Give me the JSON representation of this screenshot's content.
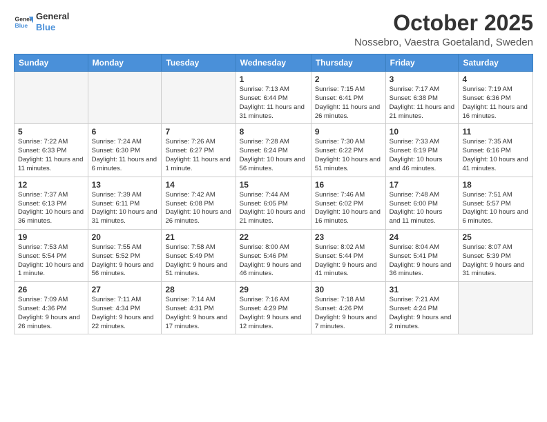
{
  "logo": {
    "line1": "General",
    "line2": "Blue"
  },
  "title": "October 2025",
  "subtitle": "Nossebro, Vaestra Goetaland, Sweden",
  "days_of_week": [
    "Sunday",
    "Monday",
    "Tuesday",
    "Wednesday",
    "Thursday",
    "Friday",
    "Saturday"
  ],
  "weeks": [
    [
      {
        "day": "",
        "info": ""
      },
      {
        "day": "",
        "info": ""
      },
      {
        "day": "",
        "info": ""
      },
      {
        "day": "1",
        "info": "Sunrise: 7:13 AM\nSunset: 6:44 PM\nDaylight: 11 hours\nand 31 minutes."
      },
      {
        "day": "2",
        "info": "Sunrise: 7:15 AM\nSunset: 6:41 PM\nDaylight: 11 hours\nand 26 minutes."
      },
      {
        "day": "3",
        "info": "Sunrise: 7:17 AM\nSunset: 6:38 PM\nDaylight: 11 hours\nand 21 minutes."
      },
      {
        "day": "4",
        "info": "Sunrise: 7:19 AM\nSunset: 6:36 PM\nDaylight: 11 hours\nand 16 minutes."
      }
    ],
    [
      {
        "day": "5",
        "info": "Sunrise: 7:22 AM\nSunset: 6:33 PM\nDaylight: 11 hours\nand 11 minutes."
      },
      {
        "day": "6",
        "info": "Sunrise: 7:24 AM\nSunset: 6:30 PM\nDaylight: 11 hours\nand 6 minutes."
      },
      {
        "day": "7",
        "info": "Sunrise: 7:26 AM\nSunset: 6:27 PM\nDaylight: 11 hours\nand 1 minute."
      },
      {
        "day": "8",
        "info": "Sunrise: 7:28 AM\nSunset: 6:24 PM\nDaylight: 10 hours\nand 56 minutes."
      },
      {
        "day": "9",
        "info": "Sunrise: 7:30 AM\nSunset: 6:22 PM\nDaylight: 10 hours\nand 51 minutes."
      },
      {
        "day": "10",
        "info": "Sunrise: 7:33 AM\nSunset: 6:19 PM\nDaylight: 10 hours\nand 46 minutes."
      },
      {
        "day": "11",
        "info": "Sunrise: 7:35 AM\nSunset: 6:16 PM\nDaylight: 10 hours\nand 41 minutes."
      }
    ],
    [
      {
        "day": "12",
        "info": "Sunrise: 7:37 AM\nSunset: 6:13 PM\nDaylight: 10 hours\nand 36 minutes."
      },
      {
        "day": "13",
        "info": "Sunrise: 7:39 AM\nSunset: 6:11 PM\nDaylight: 10 hours\nand 31 minutes."
      },
      {
        "day": "14",
        "info": "Sunrise: 7:42 AM\nSunset: 6:08 PM\nDaylight: 10 hours\nand 26 minutes."
      },
      {
        "day": "15",
        "info": "Sunrise: 7:44 AM\nSunset: 6:05 PM\nDaylight: 10 hours\nand 21 minutes."
      },
      {
        "day": "16",
        "info": "Sunrise: 7:46 AM\nSunset: 6:02 PM\nDaylight: 10 hours\nand 16 minutes."
      },
      {
        "day": "17",
        "info": "Sunrise: 7:48 AM\nSunset: 6:00 PM\nDaylight: 10 hours\nand 11 minutes."
      },
      {
        "day": "18",
        "info": "Sunrise: 7:51 AM\nSunset: 5:57 PM\nDaylight: 10 hours\nand 6 minutes."
      }
    ],
    [
      {
        "day": "19",
        "info": "Sunrise: 7:53 AM\nSunset: 5:54 PM\nDaylight: 10 hours\nand 1 minute."
      },
      {
        "day": "20",
        "info": "Sunrise: 7:55 AM\nSunset: 5:52 PM\nDaylight: 9 hours\nand 56 minutes."
      },
      {
        "day": "21",
        "info": "Sunrise: 7:58 AM\nSunset: 5:49 PM\nDaylight: 9 hours\nand 51 minutes."
      },
      {
        "day": "22",
        "info": "Sunrise: 8:00 AM\nSunset: 5:46 PM\nDaylight: 9 hours\nand 46 minutes."
      },
      {
        "day": "23",
        "info": "Sunrise: 8:02 AM\nSunset: 5:44 PM\nDaylight: 9 hours\nand 41 minutes."
      },
      {
        "day": "24",
        "info": "Sunrise: 8:04 AM\nSunset: 5:41 PM\nDaylight: 9 hours\nand 36 minutes."
      },
      {
        "day": "25",
        "info": "Sunrise: 8:07 AM\nSunset: 5:39 PM\nDaylight: 9 hours\nand 31 minutes."
      }
    ],
    [
      {
        "day": "26",
        "info": "Sunrise: 7:09 AM\nSunset: 4:36 PM\nDaylight: 9 hours\nand 26 minutes."
      },
      {
        "day": "27",
        "info": "Sunrise: 7:11 AM\nSunset: 4:34 PM\nDaylight: 9 hours\nand 22 minutes."
      },
      {
        "day": "28",
        "info": "Sunrise: 7:14 AM\nSunset: 4:31 PM\nDaylight: 9 hours\nand 17 minutes."
      },
      {
        "day": "29",
        "info": "Sunrise: 7:16 AM\nSunset: 4:29 PM\nDaylight: 9 hours\nand 12 minutes."
      },
      {
        "day": "30",
        "info": "Sunrise: 7:18 AM\nSunset: 4:26 PM\nDaylight: 9 hours\nand 7 minutes."
      },
      {
        "day": "31",
        "info": "Sunrise: 7:21 AM\nSunset: 4:24 PM\nDaylight: 9 hours\nand 2 minutes."
      },
      {
        "day": "",
        "info": ""
      }
    ]
  ]
}
